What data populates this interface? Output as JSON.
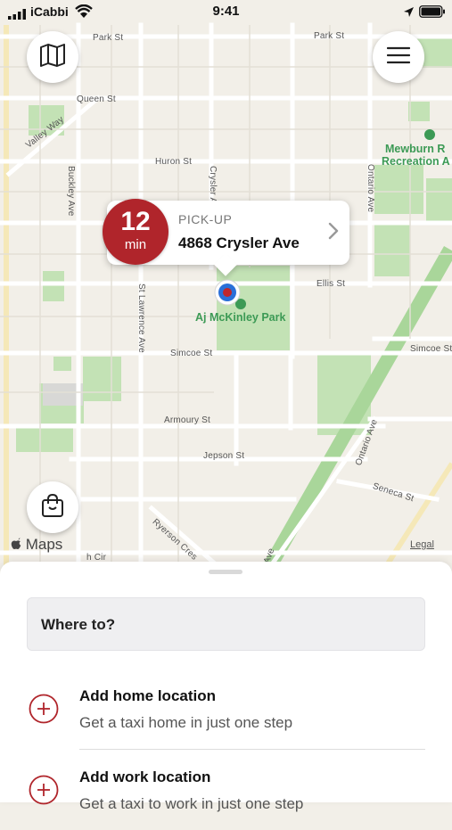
{
  "status_bar": {
    "carrier": "iCabbi",
    "time": "9:41"
  },
  "map": {
    "streets": {
      "park_st_left": "Park St",
      "park_st_right": "Park St",
      "queen_st": "Queen St",
      "valley_way": "Valley Way",
      "huron_st": "Huron St",
      "buckley_ave": "Buckley Ave",
      "crysler_ave": "Crysler Ave",
      "ontario_ave_top": "Ontario Ave",
      "ellis_st": "Ellis St",
      "st_lawrence_ave": "St Lawrence Ave",
      "simcoe_st_left": "Simcoe St",
      "simcoe_st_right": "Simcoe St",
      "armoury_st": "Armoury St",
      "jepson_st": "Jepson St",
      "ontario_ave_bottom": "Ontario Ave",
      "seneca_st": "Seneca St",
      "ryerson_cres": "Ryerson Cres",
      "bottom_cut": "h Cir",
      "bottom_ave": "Ave"
    },
    "parks": {
      "mckinley": "Aj McKinley Park",
      "mewburn_line1": "Mewburn R",
      "mewburn_line2": "Recreation A"
    },
    "maps_logo": "Maps",
    "legal": "Legal"
  },
  "pickup": {
    "eta_value": "12",
    "eta_unit": "min",
    "label": "PICK-UP",
    "address": "4868 Crysler Ave"
  },
  "icons": {
    "map_button": "map-icon",
    "menu_button": "hamburger-menu-icon",
    "bag_button": "shopping-bag-icon",
    "chevron": "chevron-right-icon",
    "add": "plus-circle-icon"
  },
  "sheet": {
    "search_placeholder": "Where to?",
    "home": {
      "title": "Add home location",
      "subtitle": "Get a taxi home in just one step"
    },
    "work": {
      "title": "Add work location",
      "subtitle": "Get a taxi to work in just one step"
    }
  },
  "colors": {
    "accent": "#b0252b",
    "park": "#bfe0b0",
    "park_label": "#3c9a55",
    "map_background": "#f2efe8"
  }
}
